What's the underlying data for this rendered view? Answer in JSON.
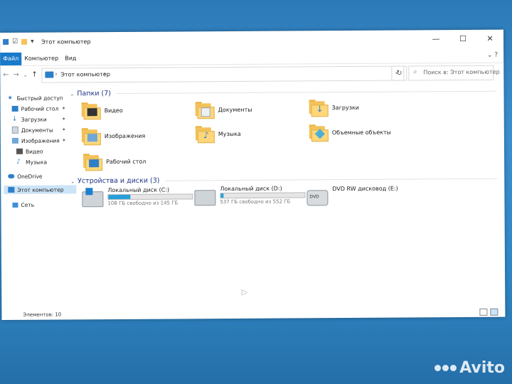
{
  "window": {
    "title": "Этот компьютер"
  },
  "ribbon": {
    "tabs": [
      "Файл",
      "Компьютер",
      "Вид"
    ]
  },
  "address": {
    "crumb": "Этот компьютер",
    "search_placeholder": "Поиск в: Этот компьютер"
  },
  "sidebar": {
    "items": [
      {
        "label": "Быстрый доступ",
        "icon": "star-icon"
      },
      {
        "label": "Рабочий стол",
        "icon": "desktop-icon",
        "pinned": true
      },
      {
        "label": "Загрузки",
        "icon": "download-icon",
        "pinned": true
      },
      {
        "label": "Документы",
        "icon": "document-icon",
        "pinned": true
      },
      {
        "label": "Изображения",
        "icon": "image-icon",
        "pinned": true
      },
      {
        "label": "Видео",
        "icon": "video-icon"
      },
      {
        "label": "Музыка",
        "icon": "music-icon"
      },
      {
        "label": "OneDrive",
        "icon": "cloud-icon"
      },
      {
        "label": "Этот компьютер",
        "icon": "computer-icon",
        "selected": true
      },
      {
        "label": "Сеть",
        "icon": "network-icon"
      }
    ]
  },
  "folders": {
    "header": "Папки (7)",
    "items": [
      {
        "label": "Видео"
      },
      {
        "label": "Документы"
      },
      {
        "label": "Загрузки"
      },
      {
        "label": "Изображения"
      },
      {
        "label": "Музыка"
      },
      {
        "label": "Объемные объекты"
      },
      {
        "label": "Рабочий стол"
      }
    ]
  },
  "devices": {
    "header": "Устройства и диски (3)",
    "items": [
      {
        "label": "Локальный диск (C:)",
        "free": "108 ГБ свободно из 145 ГБ",
        "used_fraction": 0.26
      },
      {
        "label": "Локальный диск (D:)",
        "free": "537 ГБ свободно из 552 ГБ",
        "used_fraction": 0.03
      },
      {
        "label": "DVD RW дисковод (E:)"
      }
    ]
  },
  "status": {
    "count": "Элементов: 10"
  },
  "watermark": "Avito",
  "colors": {
    "accent": "#1979ca",
    "selection": "#cce4f7",
    "drive_bar": "#26a0da",
    "group_header": "#1e3287"
  }
}
